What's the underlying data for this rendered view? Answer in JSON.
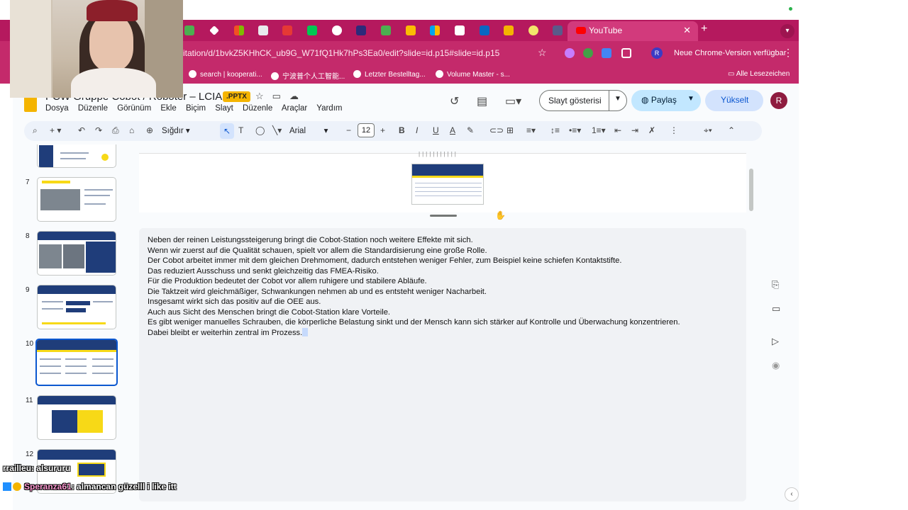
{
  "browser": {
    "active_tab_title": "YouTube",
    "url": "itation/d/1bvkZ5KHhCK_ub9G_W71fQ1Hk7hPs3Ea0/edit?slide=id.p15#slide=id.p15",
    "update_label": "Neue Chrome-Version verfügbar",
    "profile_letter": "R",
    "bookmarks": [
      "search | kooperati...",
      "宁波普个人工智能...",
      "Letzter Bestelltag...",
      "Volume Master - s..."
    ],
    "all_bookmarks": "Alle Lesezeichen",
    "colors": {
      "tabstrip": "#b5195e",
      "toolbar": "#c42a6b"
    }
  },
  "app": {
    "title": "PCW Gruppe Cobot / Roboter – LCIA 1",
    "file_badge": ".PPTX",
    "menu": [
      "Dosya",
      "Düzenle",
      "Görünüm",
      "Ekle",
      "Biçim",
      "Slayt",
      "Düzenle",
      "Araçlar",
      "Yardım"
    ],
    "slideshow_label": "Slayt gösterisi",
    "share_label": "Paylaş",
    "upgrade_label": "Yükselt",
    "user_letter": "R"
  },
  "toolbar": {
    "zoom_label": "Sığdır",
    "font_name": "Arial",
    "font_size": "12"
  },
  "filmstrip": {
    "slide_numbers": [
      "7",
      "8",
      "9",
      "10",
      "11",
      "12"
    ],
    "selected": "10"
  },
  "notes": {
    "lines": [
      "Neben der reinen Leistungssteigerung bringt die Cobot-Station noch weitere Effekte mit sich.",
      "Wenn wir zuerst auf die Qualität schauen, spielt vor allem die Standardisierung eine große Rolle.",
      "Der Cobot arbeitet immer mit dem gleichen Drehmoment, dadurch entstehen weniger Fehler, zum Beispiel keine schiefen Kontaktstifte.",
      "Das reduziert Ausschuss und senkt gleichzeitig das FMEA-Risiko.",
      "Für die Produktion bedeutet der Cobot vor allem ruhigere und stabilere Abläufe.",
      "Die Taktzeit wird gleichmäßiger, Schwankungen nehmen ab und es entsteht weniger Nacharbeit.",
      "Insgesamt wirkt sich das positiv auf die OEE aus.",
      " Auch aus Sicht des Menschen bringt die Cobot-Station klare Vorteile.",
      "Es gibt weniger manuelles Schrauben, die körperliche Belastung sinkt und der Mensch kann sich stärker auf Kontrolle und Überwachung konzentrieren.",
      "Dabei bleibt er weiterhin zentral im Prozess."
    ]
  },
  "chat": [
    {
      "user": "rrailleu",
      "message": ": alsururu"
    },
    {
      "user": "Speranza61",
      "message": ": almancan güzelll i like itt"
    }
  ]
}
